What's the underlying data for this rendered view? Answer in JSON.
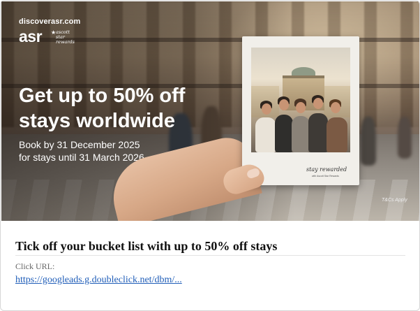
{
  "banner": {
    "logo_domain": "discoverasr.com",
    "logo_mark": "asr",
    "logo_tagline": [
      "ascott",
      "star",
      "rewards"
    ],
    "headline": "Get up to 50% off stays worldwide",
    "book_by": "Book by 31 December 2025",
    "stay_until": "for stays until 31 March 2026",
    "polaroid_caption": "stay rewarded",
    "polaroid_subcaption": "with Ascott Star Rewards",
    "terms": "T&Cs Apply"
  },
  "ad": {
    "title": "Tick off your bucket list with up to 50% off stays",
    "click_label": "Click URL:",
    "click_url": "https://googleads.g.doubleclick.net/dbm/..."
  },
  "colors": {
    "link": "#1f5db8",
    "headline": "#ffffff",
    "border": "#d6d6d6"
  }
}
